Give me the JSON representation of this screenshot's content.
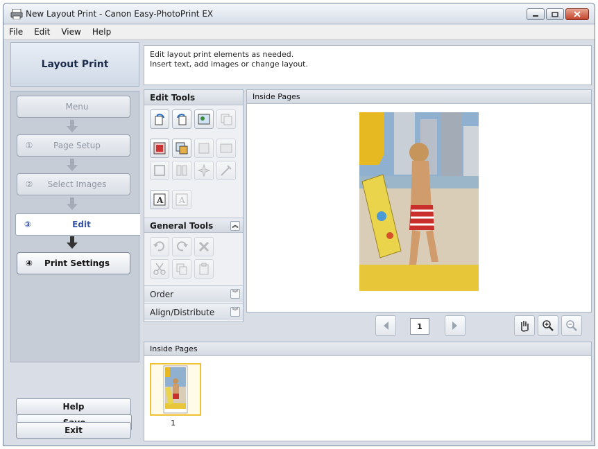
{
  "window": {
    "title": "New Layout Print - Canon Easy-PhotoPrint EX"
  },
  "menu": [
    "File",
    "Edit",
    "View",
    "Help"
  ],
  "sidebar": {
    "header": "Layout Print",
    "steps": [
      {
        "num": "",
        "label": "Menu"
      },
      {
        "num": "①",
        "label": "Page Setup"
      },
      {
        "num": "②",
        "label": "Select Images"
      },
      {
        "num": "③",
        "label": "Edit"
      },
      {
        "num": "④",
        "label": "Print Settings"
      }
    ],
    "save": "Save",
    "help": "Help",
    "exit": "Exit"
  },
  "description": {
    "line1": "Edit layout print elements as needed.",
    "line2": "Insert text, add images or change layout."
  },
  "tools": {
    "edit_title": "Edit Tools",
    "general_title": "General Tools",
    "order": "Order",
    "align": "Align/Distribute"
  },
  "preview": {
    "title": "Inside Pages",
    "page": "1"
  },
  "thumbs": {
    "title": "Inside Pages",
    "items": [
      {
        "num": "1"
      }
    ]
  },
  "colors": {
    "accent": "#3755a8",
    "selection": "#f0c030"
  }
}
